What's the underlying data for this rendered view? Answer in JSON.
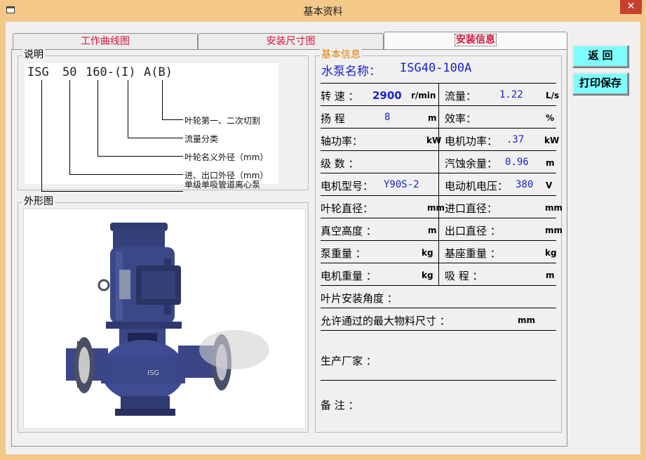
{
  "window": {
    "title": "基本资料",
    "close_glyph": "✕"
  },
  "tabs": [
    {
      "label": "工作曲线图"
    },
    {
      "label": "安装尺寸图"
    },
    {
      "label": "安装信息"
    }
  ],
  "description": {
    "group_title": "说明",
    "model_parts": [
      "ISG",
      "50",
      "160-(I)",
      "A(B)"
    ],
    "labels": [
      "叶轮第一、二次切割",
      "流量分类",
      "叶轮名义外径（mm）",
      "进、出口外径（mm）",
      "单级单吸管道离心泵"
    ]
  },
  "appearance": {
    "group_title": "外形图"
  },
  "basic_info": {
    "group_title": "基本信息",
    "pump_name_label": "水泵名称：",
    "pump_name_value": "ISG40-100A",
    "rows": [
      {
        "left_label": "转 速 ：",
        "left_value": "2900",
        "left_unit": "r/min",
        "right_label": "流量：",
        "right_value": "1.22",
        "right_unit": "L/s"
      },
      {
        "left_label": "扬 程",
        "left_value": "8",
        "left_unit": "m",
        "right_label": "效率：",
        "right_value": "",
        "right_unit": "%"
      },
      {
        "left_label": "轴功率：",
        "left_value": "",
        "left_unit": "kW",
        "right_label": "电机功率：",
        "right_value": ".37",
        "right_unit": "kW"
      },
      {
        "left_label": "级 数 ：",
        "left_value": "",
        "left_unit": "",
        "right_label": "汽蚀余量：",
        "right_value": "0.96",
        "right_unit": "m"
      },
      {
        "left_label": "电机型号：",
        "left_value": "Y90S-2",
        "left_unit": "",
        "right_label": "电动机电压：",
        "right_value": "380",
        "right_unit": "V"
      },
      {
        "left_label": "叶轮直径：",
        "left_value": "",
        "left_unit": "mm",
        "right_label": "进口直径：",
        "right_value": "",
        "right_unit": "mm"
      },
      {
        "left_label": "真空高度 ：",
        "left_value": "",
        "left_unit": "m",
        "right_label": "出口直径 ：",
        "right_value": "",
        "right_unit": "mm"
      },
      {
        "left_label": "泵重量 ：",
        "left_value": "",
        "left_unit": "kg",
        "right_label": "基座重量 ：",
        "right_value": "",
        "right_unit": "kg"
      },
      {
        "left_label": "电机重量 ：",
        "left_value": "",
        "left_unit": "kg",
        "right_label": "吸 程 ：",
        "right_value": "",
        "right_unit": "m"
      }
    ],
    "blade_angle_label": "叶片安装角度 ：",
    "max_particle_label": "允许通过的最大物料尺寸 ：",
    "max_particle_unit": "mm",
    "manufacturer_label": "生产厂家 ：",
    "remarks_label": "备  注 ："
  },
  "buttons": {
    "back": "返  回",
    "print_save": "打印保存"
  },
  "colors": {
    "title_bar": "#f4c889",
    "close_button": "#c7402f",
    "tab_text": "#d2143a",
    "value_text": "#1a24c8",
    "group_title_orange": "#e07b00",
    "side_button_bg": "#7ffcff"
  }
}
